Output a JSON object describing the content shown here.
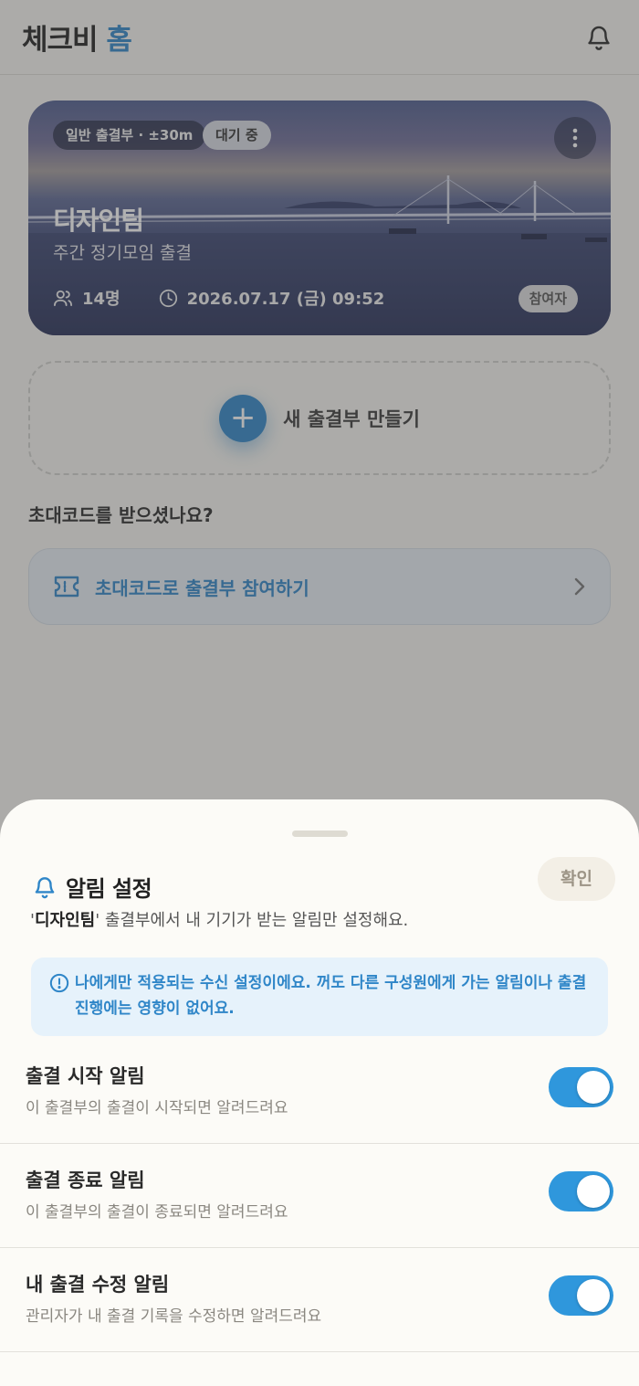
{
  "header": {
    "brand_main": "체크비",
    "brand_accent": "홈"
  },
  "event_card": {
    "type_badge": "일반 출결부 · ±30m",
    "status_badge": "대기 중",
    "title": "디자인팀",
    "subtitle": "주간 정기모임 출결",
    "members": "14명",
    "datetime": "2026.07.17 (금) 09:52",
    "role": "참여자"
  },
  "create": {
    "label": "새 출결부 만들기",
    "icon": "+"
  },
  "invite": {
    "question": "초대코드를 받으셨나요?",
    "label": "초대코드로 출결부 참여하기"
  },
  "sheet": {
    "title": "알림 설정",
    "confirm_label": "확인",
    "desc_quote_open": "'",
    "desc_name": "디자인팀",
    "desc_rest": "' 출결부에서 내 기기가 받는 알림만 설정해요.",
    "notice": "나에게만 적용되는 수신 설정이에요. 꺼도 다른 구성원에게 가는 알림이나 출결 진행에는 영향이 없어요.",
    "settings": [
      {
        "title": "출결 시작 알림",
        "desc": "이 출결부의 출결이 시작되면 알려드려요",
        "enabled": true
      },
      {
        "title": "출결 종료 알림",
        "desc": "이 출결부의 출결이 종료되면 알려드려요",
        "enabled": true
      },
      {
        "title": "내 출결 수정 알림",
        "desc": "관리자가 내 출결 기록을 수정하면 알려드려요",
        "enabled": true
      }
    ]
  },
  "colors": {
    "accent": "#2f86c8",
    "toggle_on": "#2f97dc",
    "notice_bg": "#e6f2fb"
  },
  "icons": [
    "bell-icon",
    "more-vertical-icon",
    "people-icon",
    "clock-icon",
    "ticket-icon",
    "chevron-right-icon",
    "info-icon"
  ]
}
